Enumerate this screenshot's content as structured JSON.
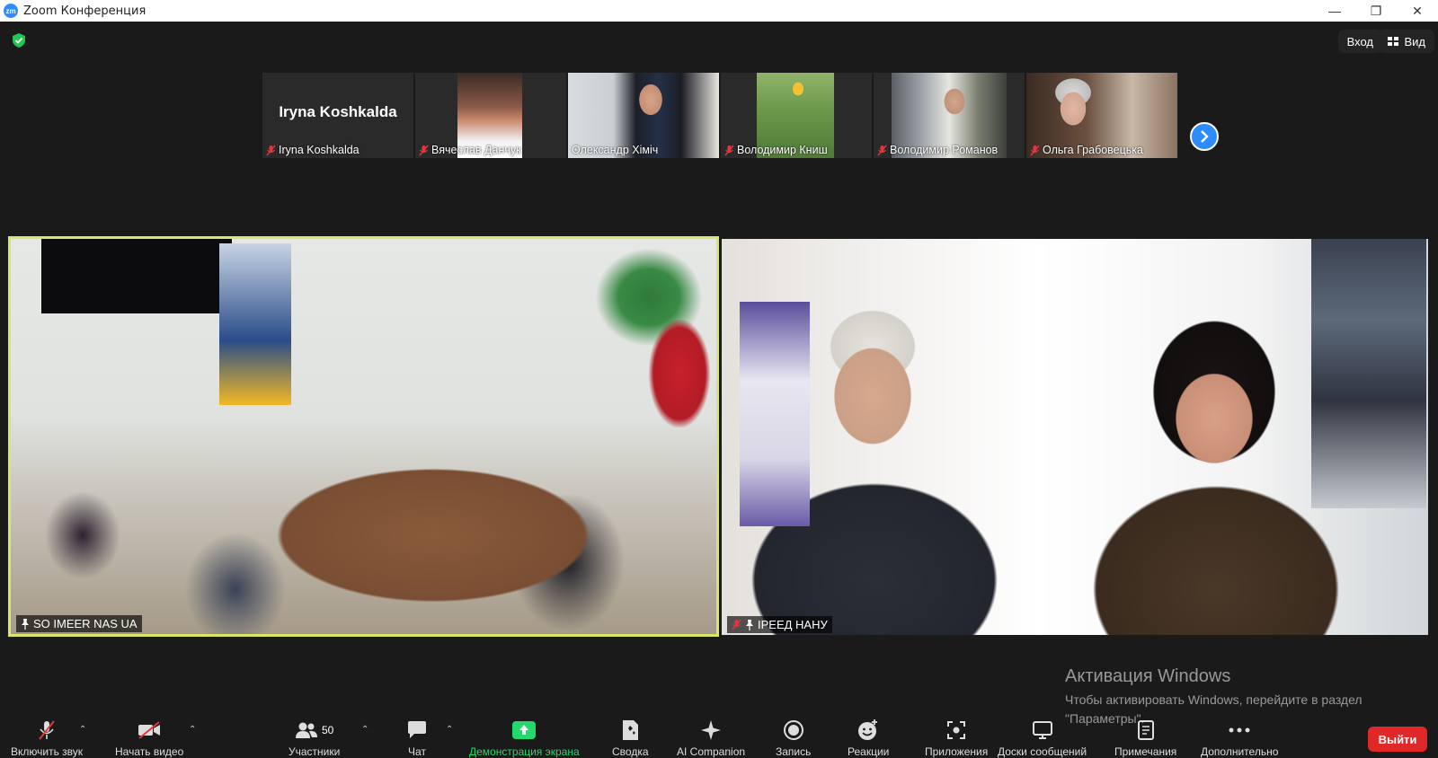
{
  "window": {
    "title": "Zoom Конференция",
    "logo_text": "zm",
    "minimize": "—",
    "restore": "❐",
    "close": "✕"
  },
  "header": {
    "login_label": "Вход",
    "view_label": "Вид"
  },
  "gallery": [
    {
      "name": "Iryna Koshkalda",
      "big_name": "Iryna Koshkalda",
      "muted": true,
      "video": false
    },
    {
      "name": "Вячеслав Данчук",
      "muted": true,
      "video": true
    },
    {
      "name": "Олександр Хіміч",
      "muted": false,
      "video": true
    },
    {
      "name": "Володимир Книш",
      "muted": true,
      "video": true
    },
    {
      "name": "Володимир Романов",
      "muted": true,
      "video": true
    },
    {
      "name": "Ольга Грабовецька",
      "muted": true,
      "video": true
    }
  ],
  "main_videos": {
    "left": {
      "label": "SO IMEER NAS UA",
      "active_speaker": true
    },
    "right": {
      "label": "ІРЕЕД НАНУ",
      "muted": true
    }
  },
  "watermark": {
    "title": "Активация Windows",
    "text": "Чтобы активировать Windows, перейдите в раздел \"Параметры\"."
  },
  "toolbar": {
    "audio": "Включить звук",
    "video": "Начать видео",
    "participants": "Участники",
    "participants_count": "50",
    "chat": "Чат",
    "share": "Демонстрация экрана",
    "summary": "Сводка",
    "ai": "AI Companion",
    "record": "Запись",
    "reactions": "Реакции",
    "apps": "Приложения",
    "whiteboards": "Доски сообщений",
    "notes": "Примечания",
    "more": "Дополнительно",
    "leave": "Выйти"
  },
  "colors": {
    "accent": "#2d8cff",
    "active_border": "#d8e66b",
    "leave": "#e02828",
    "share_green": "#23d96b",
    "mute_red": "#e0383e"
  }
}
